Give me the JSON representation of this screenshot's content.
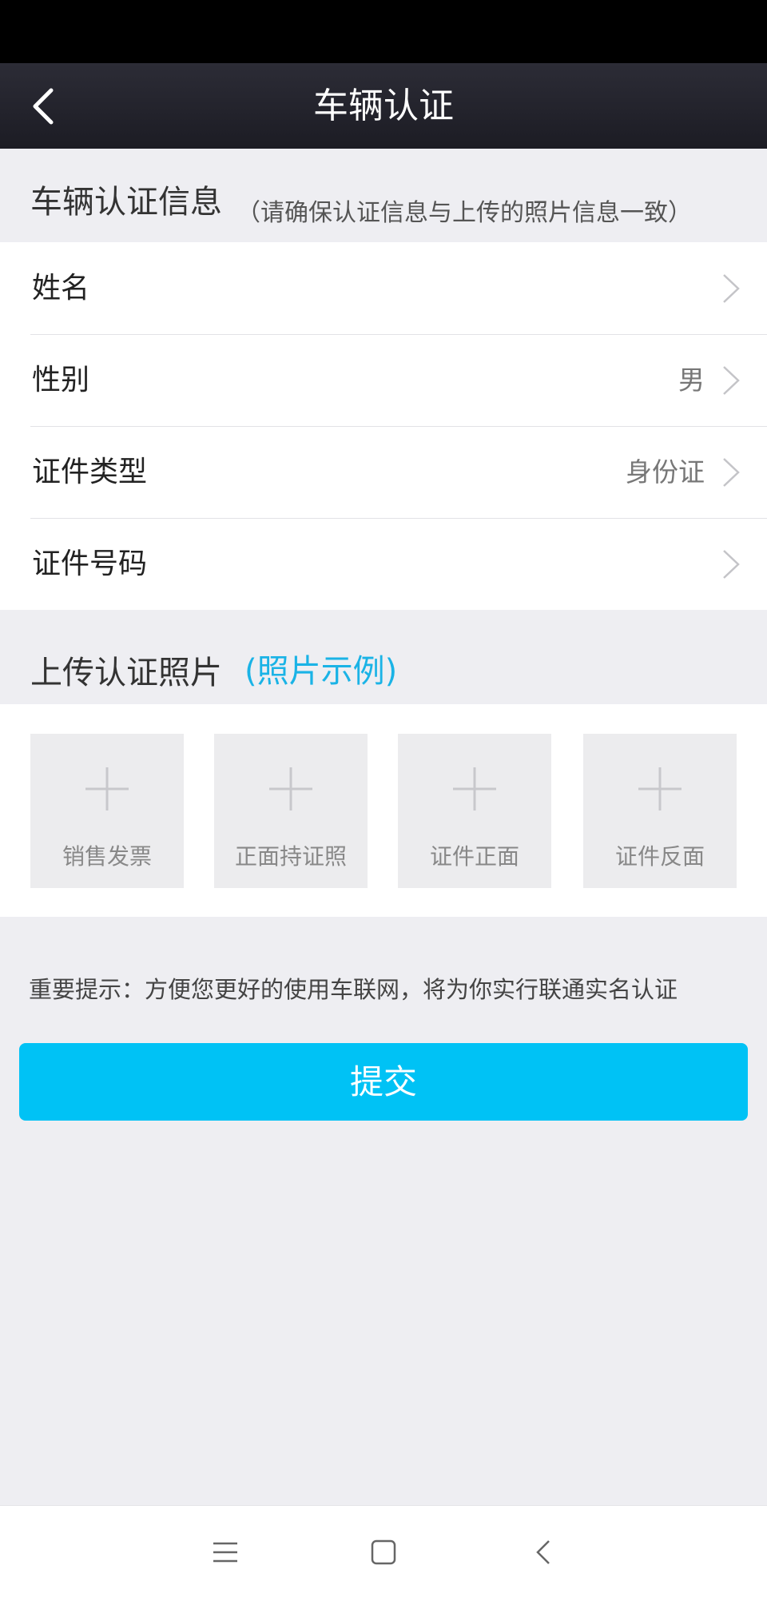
{
  "header": {
    "title": "车辆认证",
    "back_icon": "back-arrow-icon"
  },
  "info_section": {
    "title": "车辆认证信息",
    "note": "（请确保认证信息与上传的照片信息一致）"
  },
  "form_rows": [
    {
      "label": "姓名",
      "value": ""
    },
    {
      "label": "性别",
      "value": "男"
    },
    {
      "label": "证件类型",
      "value": "身份证"
    },
    {
      "label": "证件号码",
      "value": ""
    }
  ],
  "photo_section": {
    "title": "上传认证照片",
    "example_link": "(照片示例)"
  },
  "upload_tiles": [
    {
      "label": "销售发票"
    },
    {
      "label": "正面持证照"
    },
    {
      "label": "证件正面"
    },
    {
      "label": "证件反面"
    }
  ],
  "tip": "重要提示：方便您更好的使用车联网，将为你实行联通实名认证",
  "submit_label": "提交",
  "colors": {
    "accent": "#00c2f5",
    "link": "#1ab3e6",
    "nav_bar": "#22222b",
    "background": "#eeeef2"
  },
  "system_nav": {
    "icons": [
      "menu-icon",
      "home-icon",
      "back-icon"
    ]
  }
}
